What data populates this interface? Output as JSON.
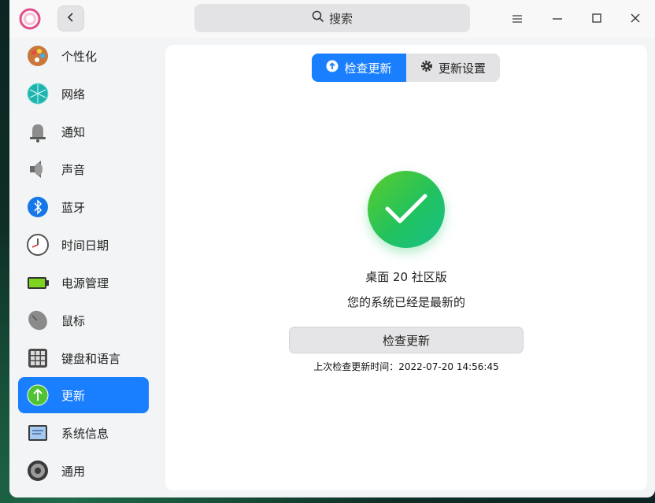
{
  "titlebar": {
    "search_placeholder": "搜索",
    "icons": [
      "settings-app-logo-icon",
      "back-arrow-icon",
      "search-icon",
      "menu-icon",
      "minimize-icon",
      "maximize-icon",
      "close-icon"
    ]
  },
  "sidebar": {
    "items": [
      {
        "label": "个性化",
        "icon": "personalization-icon"
      },
      {
        "label": "网络",
        "icon": "network-icon"
      },
      {
        "label": "通知",
        "icon": "bell-icon"
      },
      {
        "label": "声音",
        "icon": "speaker-icon"
      },
      {
        "label": "蓝牙",
        "icon": "bluetooth-icon"
      },
      {
        "label": "时间日期",
        "icon": "clock-icon"
      },
      {
        "label": "电源管理",
        "icon": "battery-icon"
      },
      {
        "label": "鼠标",
        "icon": "mouse-icon"
      },
      {
        "label": "键盘和语言",
        "icon": "keyboard-icon"
      },
      {
        "label": "更新",
        "icon": "update-arrow-icon",
        "active": true
      },
      {
        "label": "系统信息",
        "icon": "system-info-icon"
      },
      {
        "label": "通用",
        "icon": "gear-icon"
      }
    ]
  },
  "main": {
    "tabs": [
      {
        "label": "检查更新",
        "icon": "upload-circle-icon",
        "active": true
      },
      {
        "label": "更新设置",
        "icon": "gear-icon"
      }
    ],
    "edition": "桌面 20 社区版",
    "status": "您的系统已经是最新的",
    "check_button": "检查更新",
    "last_check": "上次检查更新时间：2022-07-20 14:56:45"
  },
  "colors": {
    "accent": "#1a7ffe",
    "success_green": "#2bc35a"
  }
}
